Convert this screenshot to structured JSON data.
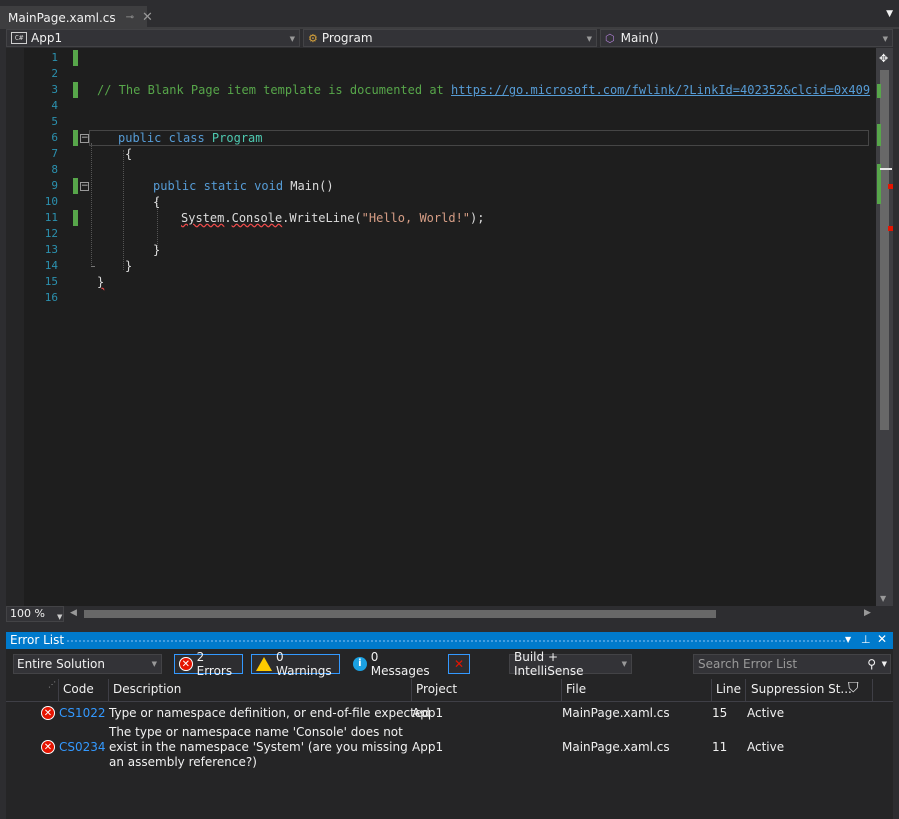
{
  "tab": {
    "title": "MainPage.xaml.cs",
    "pin_icon": "pin-icon",
    "close_icon": "close-icon"
  },
  "navbar": {
    "project": "App1",
    "class": "Program",
    "member": "Main()"
  },
  "editor": {
    "line_numbers": [
      "1",
      "2",
      "3",
      "4",
      "5",
      "6",
      "7",
      "8",
      "9",
      "10",
      "11",
      "12",
      "13",
      "14",
      "15",
      "16"
    ],
    "lines": {
      "l3_comment": "// The Blank Page item template is documented at ",
      "l3_link": "https://go.microsoft.com/fwlink/?LinkId=402352&clcid=0x409",
      "l6_kw": "public class ",
      "l6_type": "Program",
      "l7": "{",
      "l9_kw": "public static void ",
      "l9_name": "Main()",
      "l10": "{",
      "l11_err": "System",
      "l11_dot1": ".",
      "l11_console": "Console",
      "l11_rest": ".WriteLine(",
      "l11_str": "\"Hello, World!\"",
      "l11_end": ");",
      "l13": "}",
      "l14": "}",
      "l15": "}"
    },
    "zoom": "100 %"
  },
  "error_list": {
    "title": "Error List",
    "scope": "Entire Solution",
    "errors_btn": "2 Errors",
    "warnings_btn": "0 Warnings",
    "messages_btn": "0 Messages",
    "build_filter": "Build + IntelliSense",
    "search_placeholder": "Search Error List",
    "columns": {
      "code": "Code",
      "description": "Description",
      "project": "Project",
      "file": "File",
      "line": "Line",
      "suppression": "Suppression St..."
    },
    "rows": [
      {
        "code": "CS1022",
        "description": "Type or namespace definition, or end-of-file expected",
        "project": "App1",
        "file": "MainPage.xaml.cs",
        "line": "15",
        "suppression": "Active"
      },
      {
        "code": "CS0234",
        "description": "The type or namespace name 'Console' does not exist in the namespace 'System' (are you missing an assembly reference?)",
        "project": "App1",
        "file": "MainPage.xaml.cs",
        "line": "11",
        "suppression": "Active"
      }
    ]
  }
}
